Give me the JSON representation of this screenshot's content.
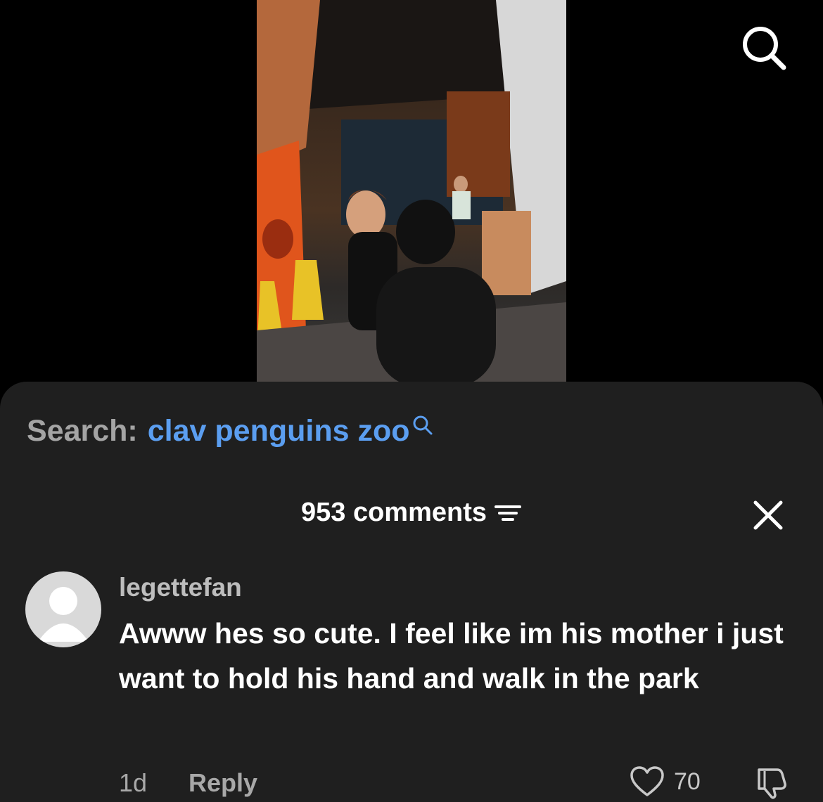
{
  "video": {
    "search_icon": "search-icon"
  },
  "sheet": {
    "search_prefix": "Search:",
    "search_query": "clav penguins zoo",
    "comments_count": "953 comments",
    "filter_icon": "filter-icon",
    "close_icon": "close-icon"
  },
  "comment": {
    "username": "legettefan",
    "text": "Awww hes so cute. I feel like im his mother i just want to hold his hand and walk in the park",
    "time": "1d",
    "reply_label": "Reply",
    "like_count": "70"
  },
  "colors": {
    "background": "#000000",
    "sheet": "#1f1f1f",
    "link_blue": "#5b9ef0",
    "muted": "#a8a8a8"
  }
}
